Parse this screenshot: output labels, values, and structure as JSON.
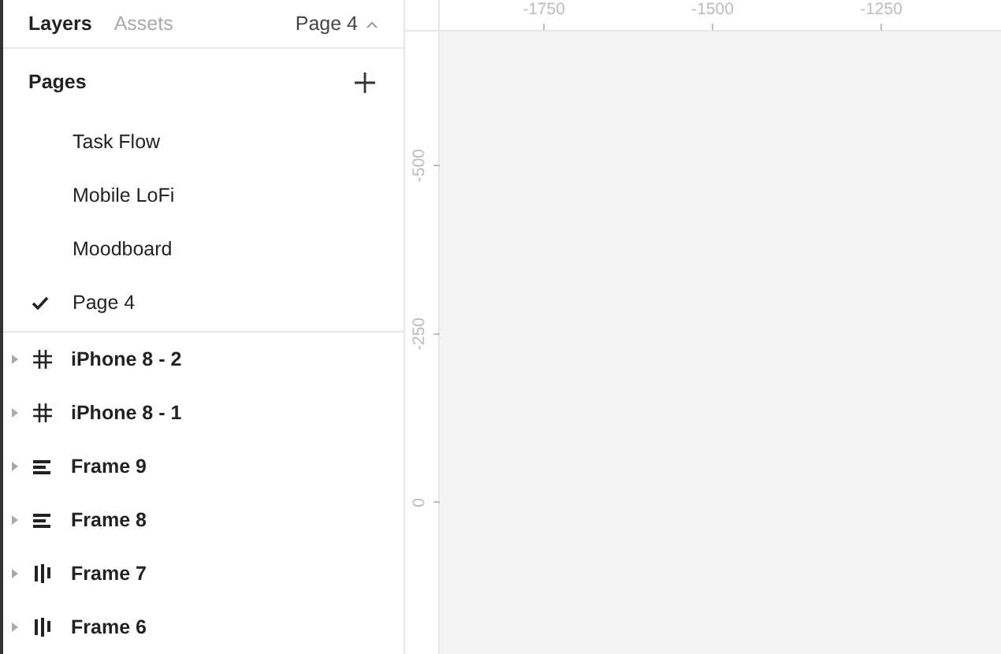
{
  "tabs": [
    {
      "label": "Layers",
      "selected": true
    },
    {
      "label": "Assets",
      "selected": false
    }
  ],
  "page_selector": {
    "label": "Page 4",
    "expanded": true
  },
  "pages": {
    "title": "Pages",
    "items": [
      {
        "label": "Task Flow",
        "selected": false
      },
      {
        "label": "Mobile LoFi",
        "selected": false
      },
      {
        "label": "Moodboard",
        "selected": false
      },
      {
        "label": "Page 4",
        "selected": true
      }
    ]
  },
  "layers": [
    {
      "label": "iPhone 8 - 2",
      "kind": "frame",
      "expanded": false
    },
    {
      "label": "iPhone 8 - 1",
      "kind": "frame",
      "expanded": false
    },
    {
      "label": "Frame 9",
      "kind": "vertical",
      "expanded": false
    },
    {
      "label": "Frame 8",
      "kind": "vertical",
      "expanded": false
    },
    {
      "label": "Frame 7",
      "kind": "horizontal",
      "expanded": false
    },
    {
      "label": "Frame 6",
      "kind": "horizontal",
      "expanded": false
    }
  ],
  "rulers": {
    "horizontal": [
      "-1750",
      "-1500",
      "-1250"
    ],
    "vertical": [
      "-500",
      "-250",
      "0"
    ]
  }
}
